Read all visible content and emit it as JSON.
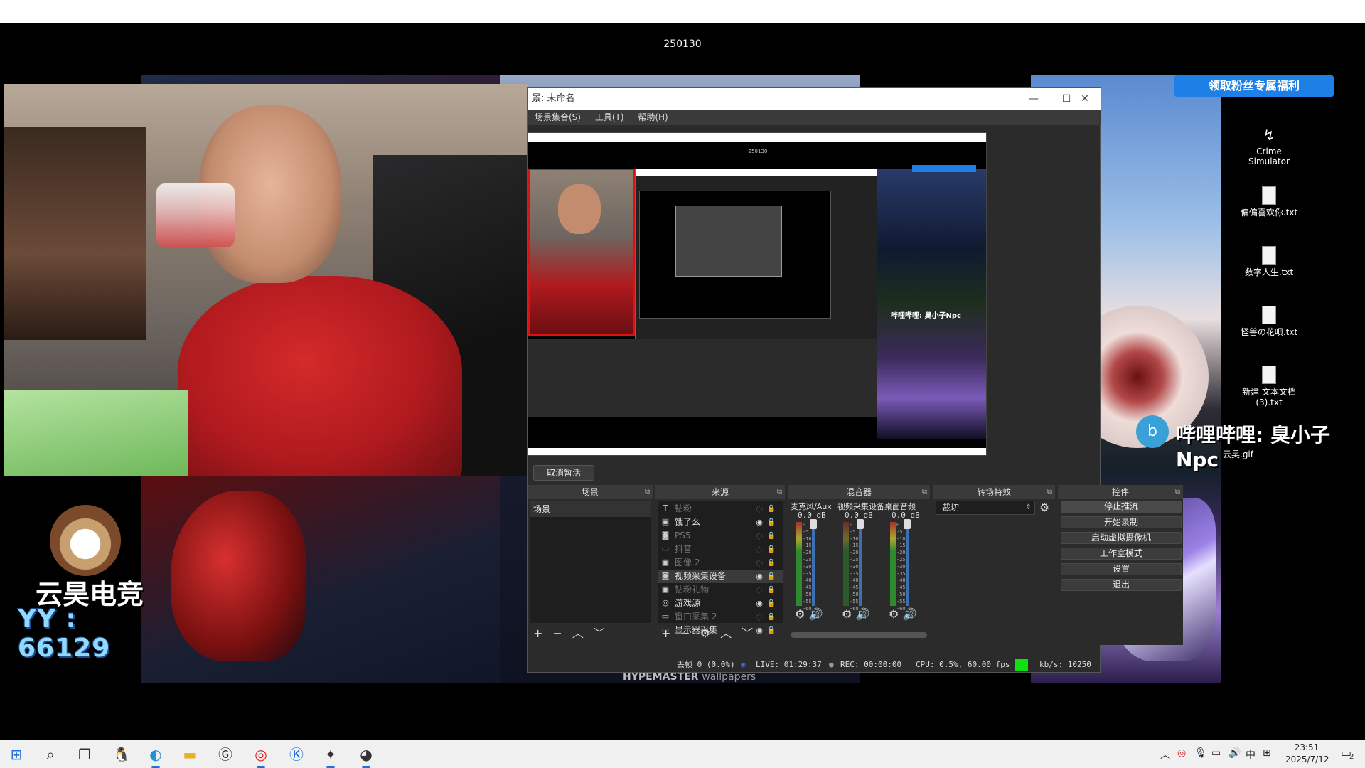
{
  "stream_title": "250130",
  "fan_button": "领取粉丝专属福利",
  "wallpaper_credit": {
    "brand": "HYPEMASTER",
    "suffix": "wallpapers"
  },
  "logo": {
    "name": "云昊电竞",
    "yy": "YY : 66129"
  },
  "bili": {
    "badge": "b",
    "text": "哔哩哔哩: 臭小子Npc"
  },
  "desktop_icons": [
    {
      "label": "Crime Simulator",
      "icon": "crime-simulator-icon"
    },
    {
      "label": "偏偏喜欢你.txt",
      "icon": "text-file-icon"
    },
    {
      "label": "数字人生.txt",
      "icon": "text-file-icon"
    },
    {
      "label": "怪兽の花呗.txt",
      "icon": "text-file-icon"
    },
    {
      "label": "新建 文本文档 (3).txt",
      "icon": "text-file-icon"
    }
  ],
  "gif_label": "云昊.gif",
  "obs": {
    "title": "景: 未命名",
    "menu": [
      "场景集合(S)",
      "工具(T)",
      "帮助(H)"
    ],
    "cancel_pause": "取消暂活",
    "preview": {
      "title": "250130",
      "bili": "哔哩哔哩: 臭小子Npc"
    },
    "docks": {
      "scenes": {
        "title": "场景",
        "items": [
          "场景"
        ]
      },
      "sources": {
        "title": "来源",
        "items": [
          {
            "icon": "T",
            "label": "钻粉",
            "visible": false
          },
          {
            "icon": "▣",
            "label": "饿了么",
            "visible": true
          },
          {
            "icon": "◙",
            "label": "PS5",
            "visible": false
          },
          {
            "icon": "▭",
            "label": "抖音",
            "visible": false
          },
          {
            "icon": "▣",
            "label": "图像 2",
            "visible": false
          },
          {
            "icon": "◙",
            "label": "视频采集设备",
            "visible": true
          },
          {
            "icon": "▣",
            "label": "钻粉礼物",
            "visible": false
          },
          {
            "icon": "◎",
            "label": "游戏源",
            "visible": true
          },
          {
            "icon": "▭",
            "label": "窗口采集 2",
            "visible": false
          },
          {
            "icon": "▭",
            "label": "显示器采集",
            "visible": true
          }
        ]
      },
      "mixer": {
        "title": "混音器",
        "channels": [
          {
            "name": "麦克风/Aux",
            "db": "0.0 dB",
            "level": 0.5
          },
          {
            "name": "视频采集设备",
            "db": "0.0 dB",
            "level": 0.0
          },
          {
            "name": "桌面音频",
            "db": "0.0 dB",
            "level": 0.5
          }
        ],
        "scale": [
          "0",
          "-5",
          "-10",
          "-15",
          "-20",
          "-25",
          "-30",
          "-35",
          "-40",
          "-45",
          "-50",
          "-55",
          "-60"
        ]
      },
      "transitions": {
        "title": "转场特效",
        "selected": "裁切"
      },
      "controls": {
        "title": "控件",
        "buttons": [
          "停止推流",
          "开始录制",
          "启动虚拟摄像机",
          "工作室模式",
          "设置",
          "退出"
        ]
      }
    },
    "status": {
      "dropped": "丢帧 0 (0.0%)",
      "live": "LIVE: 01:29:37",
      "rec": "REC: 00:00:00",
      "cpu": "CPU: 0.5%, 60.00 fps",
      "kbs": "kb/s: 10250"
    }
  },
  "taskbar": {
    "clock_time": "23:51",
    "clock_date": "2025/7/12",
    "ime": "中",
    "notif_count": "2"
  }
}
